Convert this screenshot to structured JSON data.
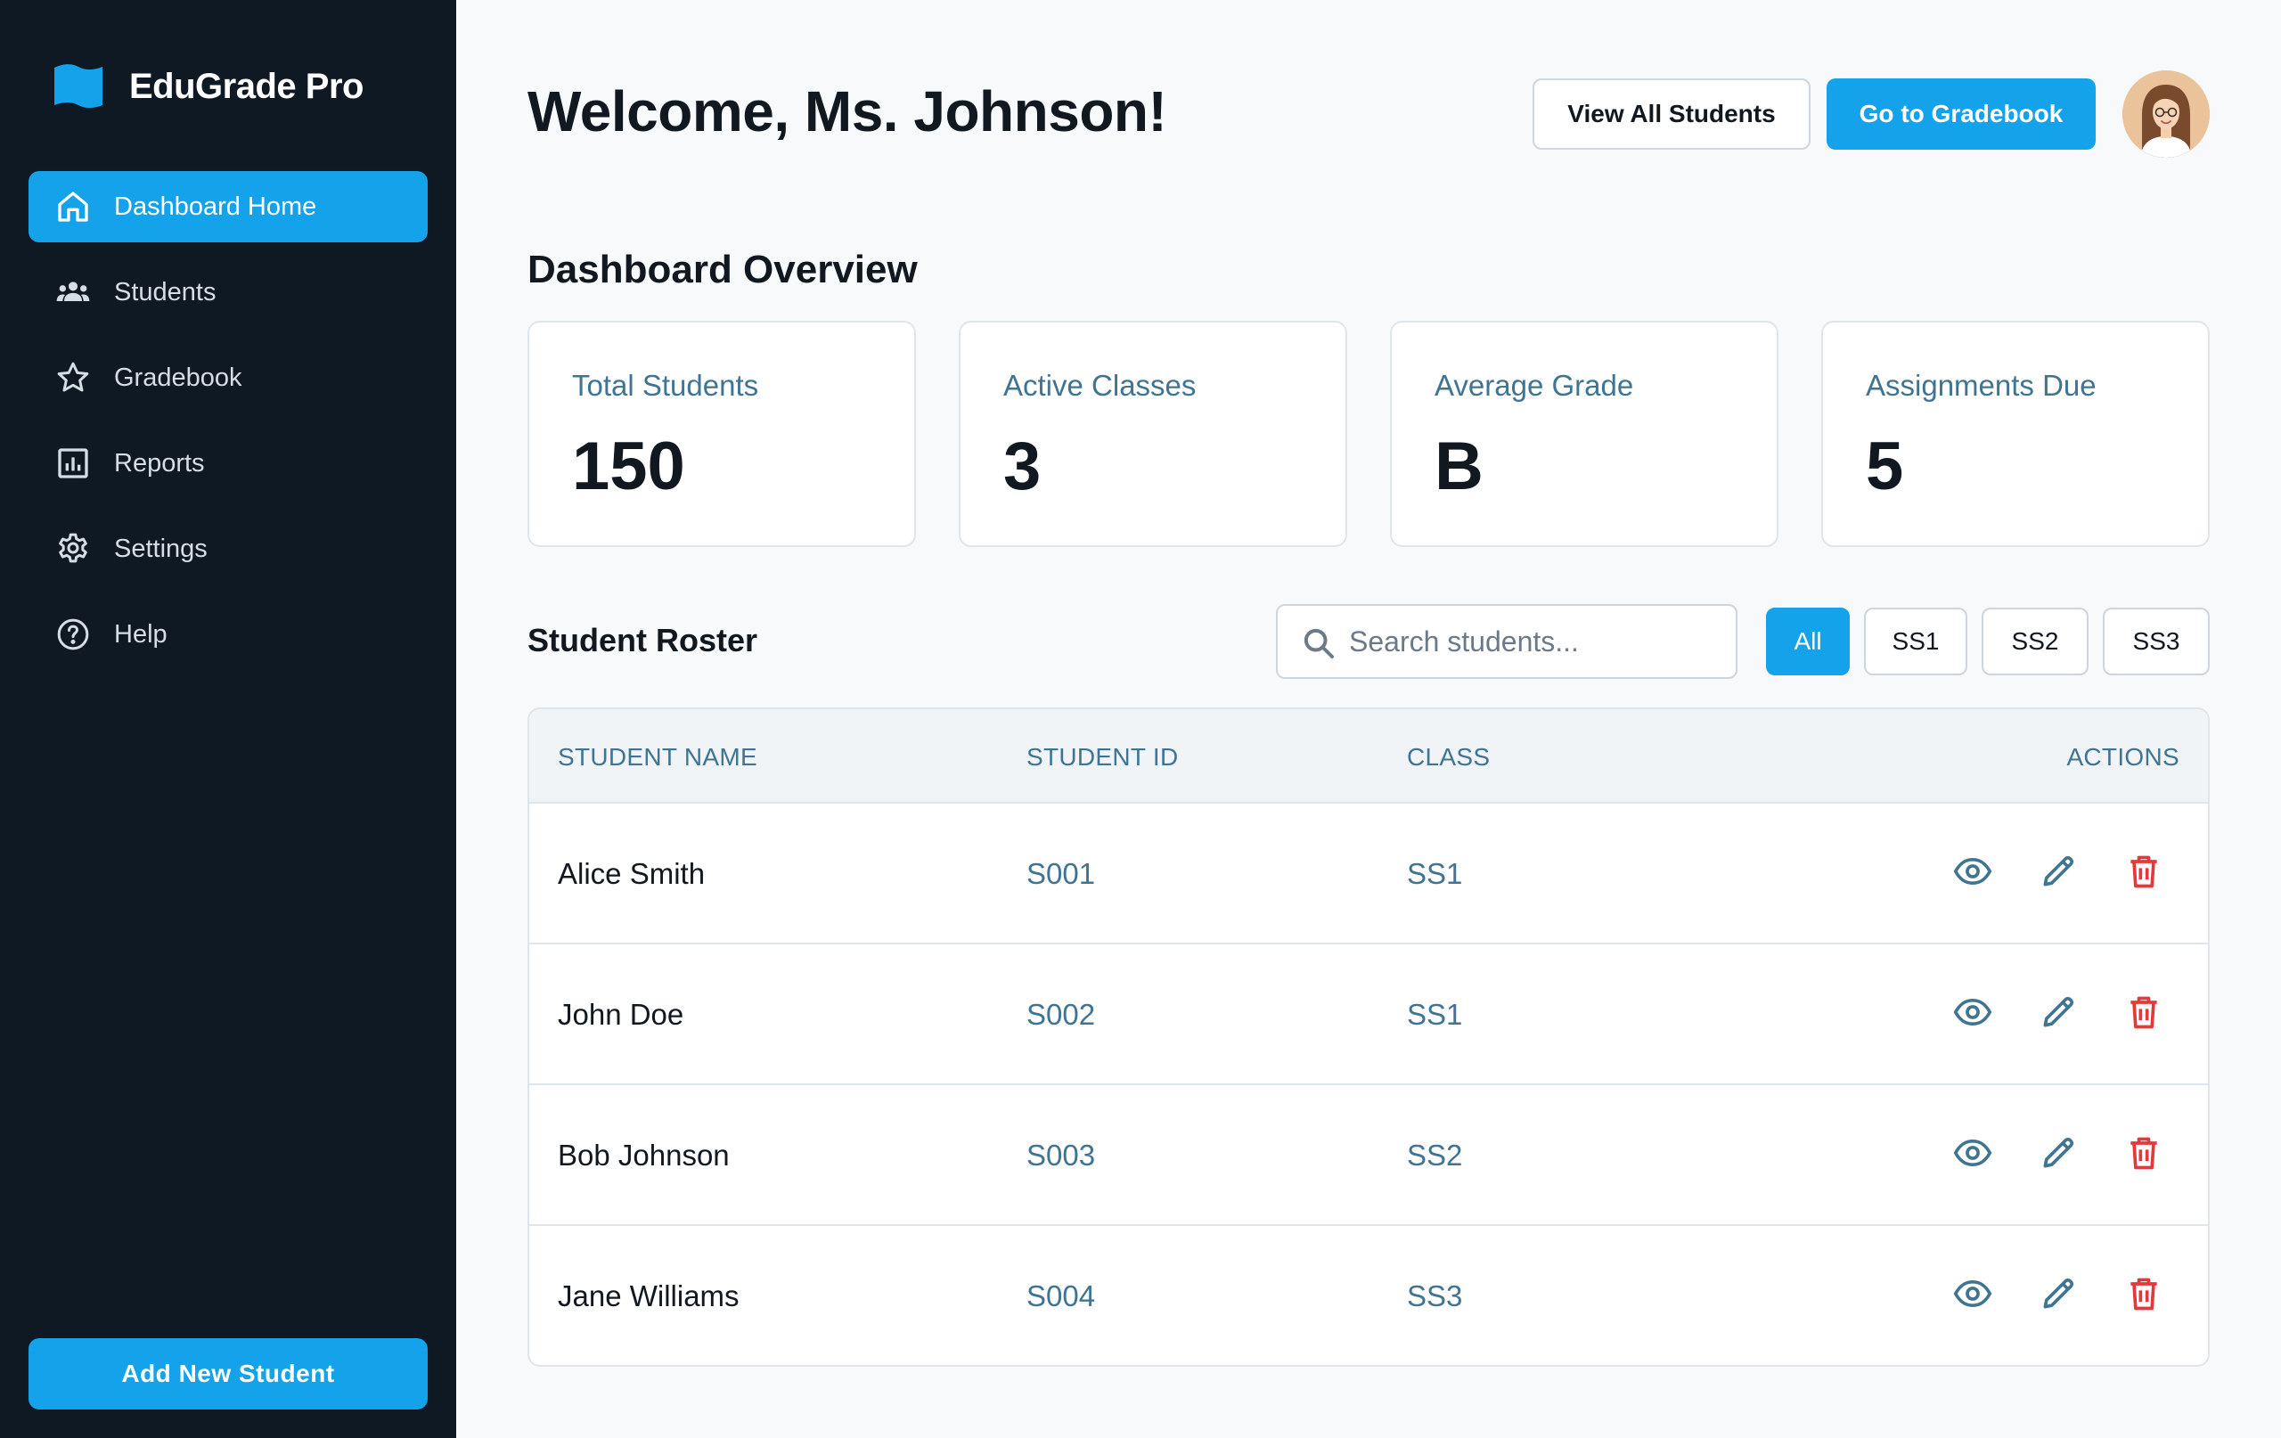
{
  "app": {
    "name": "EduGrade Pro"
  },
  "colors": {
    "accent": "#14a3ea",
    "sidebar_bg": "#0f1923",
    "muted_text": "#3f7493",
    "danger": "#e5383b"
  },
  "sidebar": {
    "items": [
      {
        "label": "Dashboard Home",
        "icon": "home-icon",
        "active": true
      },
      {
        "label": "Students",
        "icon": "users-icon",
        "active": false
      },
      {
        "label": "Gradebook",
        "icon": "star-icon",
        "active": false
      },
      {
        "label": "Reports",
        "icon": "bar-chart-icon",
        "active": false
      },
      {
        "label": "Settings",
        "icon": "gear-icon",
        "active": false
      },
      {
        "label": "Help",
        "icon": "help-icon",
        "active": false
      }
    ],
    "add_button": "Add New Student"
  },
  "header": {
    "title": "Welcome, Ms. Johnson!",
    "view_all_label": "View All Students",
    "gradebook_label": "Go to Gradebook"
  },
  "overview": {
    "title": "Dashboard Overview",
    "cards": [
      {
        "label": "Total Students",
        "value": "150"
      },
      {
        "label": "Active Classes",
        "value": "3"
      },
      {
        "label": "Average Grade",
        "value": "B"
      },
      {
        "label": "Assignments Due",
        "value": "5"
      }
    ]
  },
  "roster": {
    "title": "Student Roster",
    "search_placeholder": "Search students...",
    "filters": [
      {
        "label": "All",
        "active": true
      },
      {
        "label": "SS1",
        "active": false
      },
      {
        "label": "SS2",
        "active": false
      },
      {
        "label": "SS3",
        "active": false
      }
    ],
    "columns": [
      "STUDENT NAME",
      "STUDENT ID",
      "CLASS",
      "ACTIONS"
    ],
    "rows": [
      {
        "name": "Alice Smith",
        "id": "S001",
        "class": "SS1"
      },
      {
        "name": "John Doe",
        "id": "S002",
        "class": "SS1"
      },
      {
        "name": "Bob Johnson",
        "id": "S003",
        "class": "SS2"
      },
      {
        "name": "Jane Williams",
        "id": "S004",
        "class": "SS3"
      }
    ],
    "actions": [
      "eye-icon",
      "pencil-icon",
      "trash-icon"
    ]
  }
}
